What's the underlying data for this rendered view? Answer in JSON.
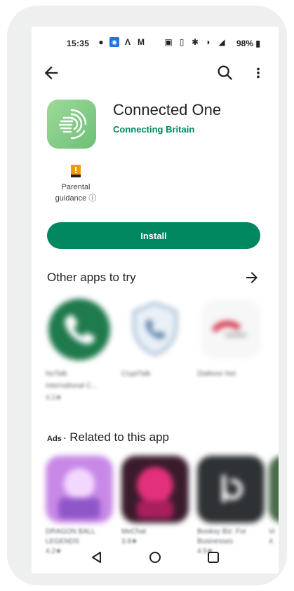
{
  "status_bar": {
    "time": "15:35",
    "battery": "98%",
    "icons": [
      "chat-bubble-icon",
      "messages-icon",
      "a-icon",
      "gmail-icon",
      "nfc-icon",
      "vibrate-icon",
      "bluetooth-icon",
      "wifi-icon",
      "signal-icon",
      "battery-icon"
    ]
  },
  "app": {
    "title": "Connected One",
    "developer": "Connecting Britain",
    "icon": "connected-one-app-icon",
    "rating_badge": {
      "line1": "Parental",
      "line2": "guidance ⓘ"
    },
    "install_label": "Install"
  },
  "sections": {
    "other_apps_title": "Other apps to try",
    "ads_tag": "Ads ·",
    "related_title": "Related to this app"
  },
  "other_apps": [
    {
      "name": "NoTalk",
      "sub": "International C...",
      "meta": "4.1★",
      "color": "#1f7a4d"
    },
    {
      "name": "CryptTalk",
      "sub": "",
      "meta": "",
      "color": "#c9dced"
    },
    {
      "name": "Dialtone Net",
      "sub": "",
      "meta": "",
      "color": "#f2dede"
    }
  ],
  "related_apps": [
    {
      "name": "DRAGON BALL",
      "sub": "LEGENDS",
      "meta": "4.2★",
      "color": "#c889e6"
    },
    {
      "name": "MeChat",
      "sub": "",
      "meta": "3.9★",
      "color": "#d33c7e"
    },
    {
      "name": "Booksy Biz: For",
      "sub": "Businesses",
      "meta": "4.5★",
      "color": "#2f3235"
    },
    {
      "name": "Vi",
      "sub": "",
      "meta": "4.",
      "color": "#4b6b4a"
    }
  ],
  "colors": {
    "accent": "#01875f",
    "frame": "#eef0ef"
  }
}
